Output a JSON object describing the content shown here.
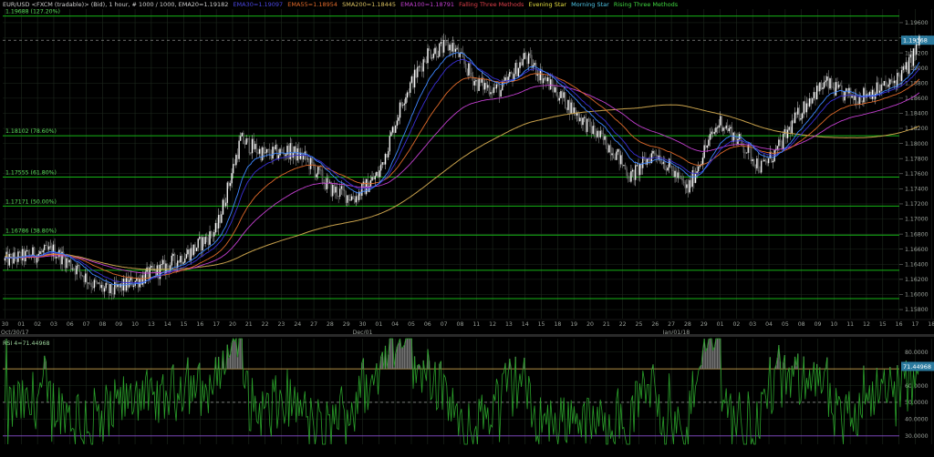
{
  "header": {
    "symbol": "EUR/USD <FXCM (tradable)> (Bid), 1 hour, # 1000 / 1000, EMA20=1.19182",
    "ema30": "EMA30=1.19097",
    "ema55": "EMA55=1.18954",
    "sma200": "SMA200=1.18445",
    "ema100": "EMA100=1.18791",
    "pattern1": "Falling Three Methods",
    "pattern2": "Evening Star",
    "pattern3": "Morning Star",
    "pattern4": "Rising Three Methods"
  },
  "colors": {
    "background": "#000000",
    "grid": "#1e2a1e",
    "fib_line": "#16b516",
    "candle_up": "#d8d8d8",
    "candle_down": "#9a9a9a",
    "ema20": "#3e86ff",
    "ema30": "#3a2fd6",
    "ema55": "#e06a2a",
    "ema100": "#c33fd0",
    "sma200": "#c9a24c",
    "rsi_line": "#2aa02a",
    "rsi_70": "#c9a24c",
    "rsi_30": "#8a4fd0",
    "price_badge": "#2b7a9e",
    "axis_text": "#9aa09a"
  },
  "chart_data": [
    {
      "type": "candlestick",
      "ylim": [
        1.1568,
        1.1978
      ],
      "yticks": [
        1.196,
        1.194,
        1.192,
        1.19,
        1.188,
        1.186,
        1.184,
        1.182,
        1.18,
        1.178,
        1.176,
        1.174,
        1.172,
        1.17,
        1.168,
        1.166,
        1.164,
        1.162,
        1.16,
        1.158
      ],
      "ytick_labels": [
        "1.19600",
        "1.19400",
        "1.19200",
        "1.19000",
        "1.18800",
        "1.18600",
        "1.18400",
        "1.18200",
        "1.18000",
        "1.17800",
        "1.17600",
        "1.17400",
        "1.17200",
        "1.17000",
        "1.16800",
        "1.16600",
        "1.16400",
        "1.16200",
        "1.16000",
        "1.15800"
      ],
      "current_price": "1.19368",
      "current_price_value": 1.19368,
      "fib_levels": [
        {
          "label": "1.19688 (127.20%)",
          "value": 1.19688
        },
        {
          "label": "1.18102 (78.60%)",
          "value": 1.18102
        },
        {
          "label": "1.17555 (61.80%)",
          "value": 1.17555
        },
        {
          "label": "1.17171 (50.00%)",
          "value": 1.17171
        },
        {
          "label": "1.16786 (38.80%)",
          "value": 1.16786
        },
        {
          "label": "",
          "value": 1.1632
        },
        {
          "label": "",
          "value": 1.15945
        }
      ],
      "x_labels": [
        "30",
        "01",
        "02",
        "03",
        "06",
        "07",
        "08",
        "09",
        "10",
        "13",
        "14",
        "15",
        "16",
        "17",
        "20",
        "21",
        "22",
        "23",
        "24",
        "27",
        "28",
        "29",
        "30",
        "01",
        "04",
        "05",
        "06",
        "07",
        "08",
        "11",
        "12",
        "13",
        "14",
        "15",
        "18",
        "19",
        "20",
        "21",
        "22",
        "25",
        "26",
        "27",
        "28",
        "29",
        "01",
        "02",
        "03",
        "04",
        "05",
        "08",
        "09",
        "10",
        "11",
        "12",
        "15",
        "16",
        "17",
        "18",
        "19"
      ],
      "x_label_rows": {
        "left": "Oct/30/17",
        "mid": "Dec/01",
        "right": "Jan/01/18"
      },
      "price_anchors": [
        [
          0,
          1.1645
        ],
        [
          3,
          1.1658
        ],
        [
          4.5,
          1.1632
        ],
        [
          5.5,
          1.1612
        ],
        [
          6.5,
          1.1603
        ],
        [
          8,
          1.1618
        ],
        [
          9.5,
          1.1632
        ],
        [
          11.5,
          1.1658
        ],
        [
          13,
          1.1685
        ],
        [
          14.5,
          1.1805
        ],
        [
          16,
          1.1785
        ],
        [
          17.5,
          1.179
        ],
        [
          18.5,
          1.178
        ],
        [
          20,
          1.174
        ],
        [
          21.5,
          1.1728
        ],
        [
          23,
          1.176
        ],
        [
          24.5,
          1.186
        ],
        [
          26,
          1.192
        ],
        [
          27.5,
          1.193
        ],
        [
          29,
          1.188
        ],
        [
          30.5,
          1.187
        ],
        [
          32,
          1.1915
        ],
        [
          33,
          1.189
        ],
        [
          34.5,
          1.1855
        ],
        [
          36,
          1.182
        ],
        [
          37.5,
          1.179
        ],
        [
          38.5,
          1.1755
        ],
        [
          40,
          1.179
        ],
        [
          41,
          1.1765
        ],
        [
          42,
          1.1738
        ],
        [
          43,
          1.179
        ],
        [
          44,
          1.183
        ],
        [
          45.5,
          1.1795
        ],
        [
          46.5,
          1.1768
        ],
        [
          47.5,
          1.179
        ],
        [
          48.5,
          1.1828
        ],
        [
          49.5,
          1.186
        ],
        [
          50.5,
          1.188
        ],
        [
          51.5,
          1.1865
        ],
        [
          52.5,
          1.1862
        ],
        [
          53.5,
          1.187
        ],
        [
          54.5,
          1.1878
        ],
        [
          55.5,
          1.19
        ],
        [
          56.3,
          1.1936
        ]
      ],
      "rsi": {
        "label": "RSI 4=71.44968",
        "value_label": "71.44968",
        "ylim": [
          25,
          88
        ],
        "yticks": [
          80,
          70,
          60,
          50,
          40,
          30
        ],
        "ytick_labels": [
          "80.0000",
          "70.0000",
          "60.0000",
          "50.0000",
          "40.0000",
          "30.0000"
        ],
        "overbought": 70,
        "oversold": 30,
        "current": 71.44968
      }
    }
  ]
}
